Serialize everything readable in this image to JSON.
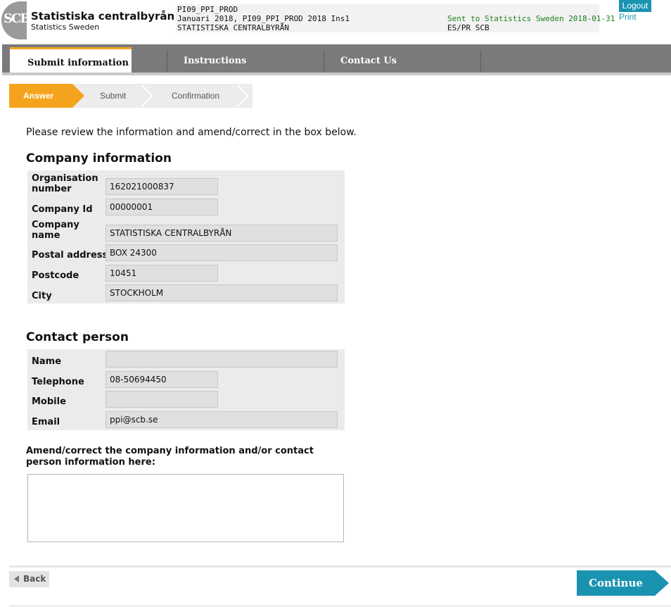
{
  "header": {
    "logo_mark": "SCB",
    "logo_name": "Statistiska centralbyrån",
    "logo_sub": "Statistics Sweden",
    "survey_code": "PI09_PPI_PROD",
    "survey_period": "Januari 2018, PI09_PPI_PROD 2018 Ins1",
    "org_name": "STATISTISKA CENTRALBYRÅN",
    "sent_status": "Sent to Statistics Sweden 2018-01-31",
    "unit": "ES/PR SCB",
    "logout_label": "Logout",
    "print_label": "Print"
  },
  "nav": {
    "tabs": [
      {
        "label": "Submit information"
      },
      {
        "label": "Instructions"
      },
      {
        "label": "Contact Us"
      }
    ]
  },
  "steps": [
    {
      "label": "Answer"
    },
    {
      "label": "Submit"
    },
    {
      "label": "Confirmation"
    }
  ],
  "intro": "Please review the information and amend/correct in the box below.",
  "company": {
    "heading": "Company information",
    "fields": [
      {
        "label": "Organisation number",
        "value": "162021000837"
      },
      {
        "label": "Company Id",
        "value": "00000001"
      },
      {
        "label": "Company name",
        "value": "STATISTISKA CENTRALBYRÅN"
      },
      {
        "label": "Postal address",
        "value": "BOX 24300"
      },
      {
        "label": "Postcode",
        "value": "10451"
      },
      {
        "label": "City",
        "value": "STOCKHOLM"
      }
    ]
  },
  "contact": {
    "heading": "Contact person",
    "fields": [
      {
        "label": "Name",
        "value": ""
      },
      {
        "label": "Telephone",
        "value": "08-50694450"
      },
      {
        "label": "Mobile",
        "value": ""
      },
      {
        "label": "Email",
        "value": "ppi@scb.se"
      }
    ]
  },
  "amend": {
    "label": "Amend/correct the company information and/or contact person information here:",
    "value": ""
  },
  "footer": {
    "back_label": "Back",
    "continue_label": "Continue"
  },
  "colors": {
    "accent": "#f5a31c",
    "primary": "#1a93b0",
    "nav_bg": "#7a7a7a",
    "sent_green": "#1e7d1e"
  }
}
